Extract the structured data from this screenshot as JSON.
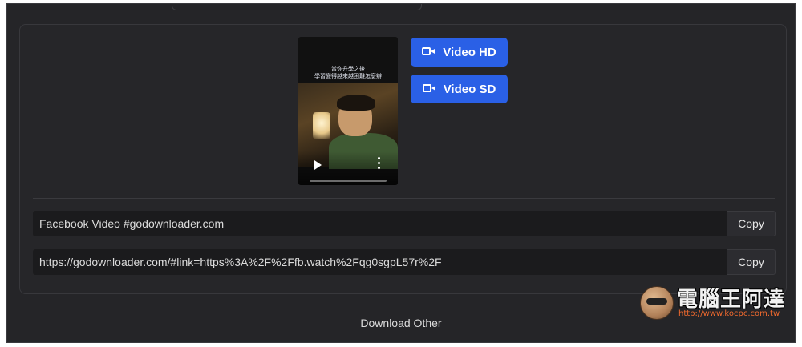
{
  "video": {
    "caption_line1": "當你升學之後",
    "caption_line2": "學習變得越來越困難怎麼辦"
  },
  "buttons": {
    "hd_label": "Video HD",
    "sd_label": "Video SD"
  },
  "rows": [
    {
      "value": "Facebook Video #godownloader.com",
      "copy_label": "Copy"
    },
    {
      "value": "https://godownloader.com/#link=https%3A%2F%2Ffb.watch%2Fqg0sgpL57r%2F",
      "copy_label": "Copy"
    }
  ],
  "footer": {
    "download_other_label": "Download Other"
  },
  "watermark": {
    "title": "電腦王阿達",
    "url": "http://www.kocpc.com.tw"
  },
  "colors": {
    "accent": "#2a60e6",
    "background": "#252528",
    "field": "#1b1b1d"
  }
}
